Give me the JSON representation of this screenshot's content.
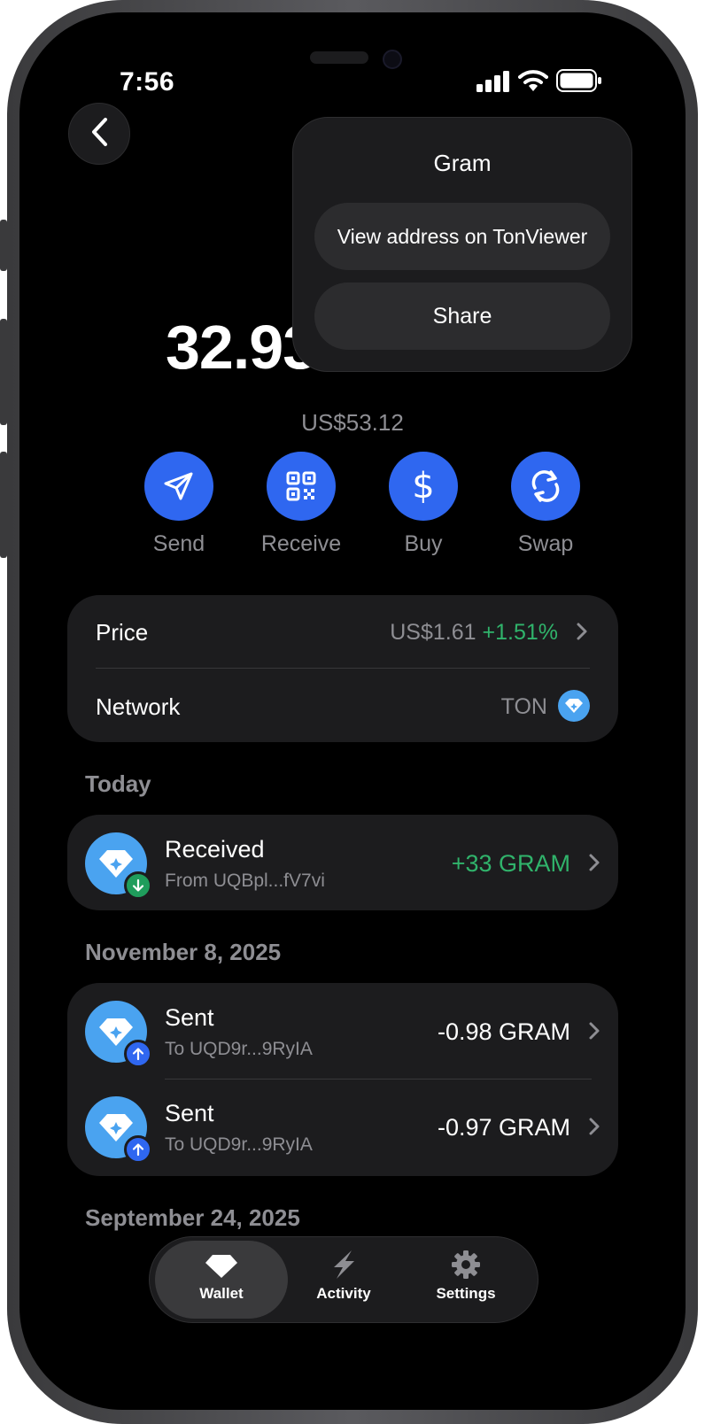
{
  "status_bar": {
    "time": "7:56"
  },
  "wallet": {
    "balance": "32.93",
    "fiat_balance": "US$53.12"
  },
  "actions": [
    {
      "label": "Send",
      "icon": "send-icon"
    },
    {
      "label": "Receive",
      "icon": "qr-code-icon"
    },
    {
      "label": "Buy",
      "icon": "dollar-icon"
    },
    {
      "label": "Swap",
      "icon": "swap-icon"
    }
  ],
  "info": {
    "price_label": "Price",
    "price_value": "US$1.61",
    "price_change": "+1.51%",
    "network_label": "Network",
    "network_value": "TON"
  },
  "sections": {
    "today": "Today",
    "nov": "November 8, 2025",
    "sep": "September 24, 2025"
  },
  "transactions": {
    "today": [
      {
        "title": "Received",
        "sub": "From UQBpl...fV7vi",
        "amount": "+33 GRAM",
        "direction": "in"
      }
    ],
    "nov": [
      {
        "title": "Sent",
        "sub": "To UQD9r...9RyIA",
        "amount": "-0.98 GRAM",
        "direction": "out"
      },
      {
        "title": "Sent",
        "sub": "To UQD9r...9RyIA",
        "amount": "-0.97 GRAM",
        "direction": "out"
      }
    ]
  },
  "popup": {
    "title": "Gram",
    "view_address": "View address on TonViewer",
    "share": "Share"
  },
  "tabbar": {
    "wallet": "Wallet",
    "activity": "Activity",
    "settings": "Settings"
  },
  "colors": {
    "accent": "#2f67f0",
    "positive": "#30b36b",
    "ton_blue": "#4aa3f0",
    "card": "#1c1c1e",
    "muted": "#8e8e93"
  }
}
